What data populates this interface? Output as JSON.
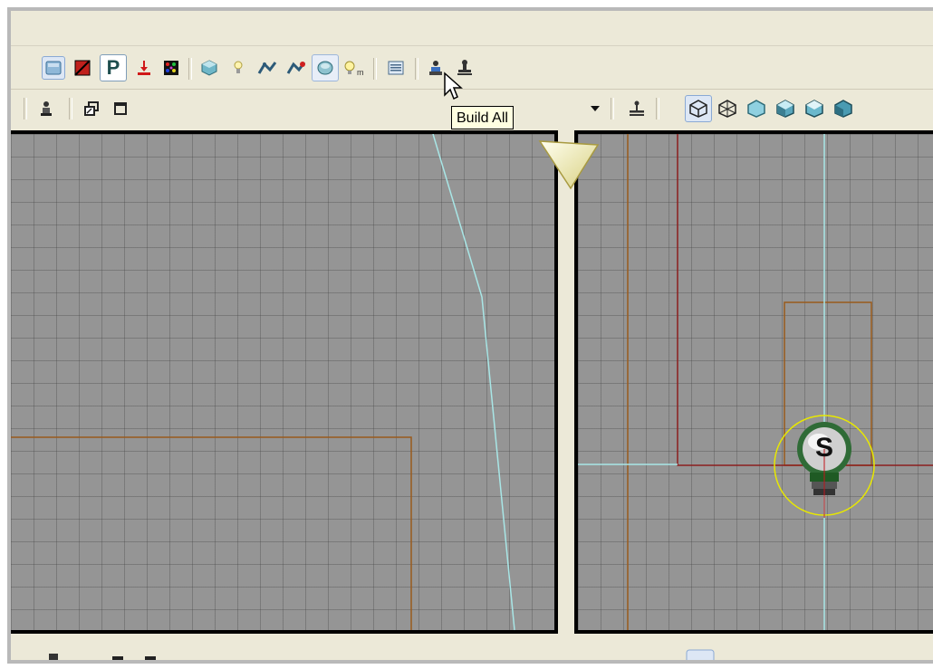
{
  "tooltip": {
    "text": "Build All"
  },
  "toolbar_main": {
    "items": [
      {
        "name": "camera-view-icon",
        "selected": true
      },
      {
        "name": "brush-red-icon"
      },
      {
        "name": "path-p-icon",
        "label": "P"
      },
      {
        "name": "drop-to-floor-icon"
      },
      {
        "name": "texture-palette-icon"
      },
      {
        "name": "build-geometry-icon"
      },
      {
        "name": "build-lighting-icon"
      },
      {
        "name": "build-paths-icon"
      },
      {
        "name": "build-cover-icon"
      },
      {
        "name": "build-all-icon",
        "hovered": true
      },
      {
        "name": "light-m-icon"
      },
      {
        "name": "properties-window-icon"
      },
      {
        "name": "actor-browser-icon"
      },
      {
        "name": "stamp-icon"
      }
    ]
  },
  "toolbar_view": {
    "items": [
      {
        "name": "actor-tool-icon"
      },
      {
        "name": "restore-window-icon"
      },
      {
        "name": "maximize-window-icon"
      },
      {
        "name": "dropdown-arrow-icon"
      },
      {
        "name": "snap-stamp-icon"
      },
      {
        "name": "wireframe-cube-icon",
        "selected": true
      },
      {
        "name": "brush-wire-cube-icon"
      },
      {
        "name": "unlit-cube-icon"
      },
      {
        "name": "lit-cube-icon"
      },
      {
        "name": "detail-cube-icon"
      },
      {
        "name": "lighting-only-cube-icon"
      }
    ]
  },
  "viewport_right": {
    "light_actor": {
      "label": "S"
    }
  },
  "colors": {
    "grid_bg": "#959595",
    "path_line": "#a8e6e6",
    "brush_line": "#9a5b1c",
    "builder_brush": "#8c1e1e",
    "selection_circle": "#e8e800",
    "tooltip_bg": "#ffffe1"
  }
}
